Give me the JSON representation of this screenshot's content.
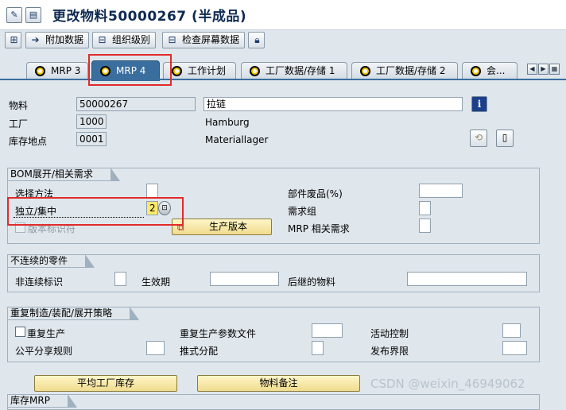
{
  "window": {
    "title": "更改物料50000267 (半成品)"
  },
  "toolbar": {
    "additional_data_label": "附加数据",
    "org_levels_label": "组织级别",
    "check_screen_data_label": "检查屏幕数据"
  },
  "tabs": [
    {
      "label": "MRP 3"
    },
    {
      "label": "MRP 4",
      "active": true
    },
    {
      "label": "工作计划"
    },
    {
      "label": "工厂数据/存储 1"
    },
    {
      "label": "工厂数据/存储 2"
    },
    {
      "label": "会..."
    }
  ],
  "header": {
    "material_label": "物料",
    "material_value": "50000267",
    "material_desc": "拉链",
    "plant_label": "工厂",
    "plant_value": "1000",
    "plant_desc": "Hamburg",
    "sloc_label": "库存地点",
    "sloc_value": "0001",
    "sloc_desc": "Materiallager"
  },
  "bom_group": {
    "title": "BOM展开/相关需求",
    "selection_method_label": "选择方法",
    "selection_method_value": "",
    "indiv_coll_label": "独立/集中",
    "indiv_coll_value": "2",
    "version_indicator_label": "版本标识符",
    "component_scrap_label": "部件废品(%)",
    "component_scrap_value": "",
    "req_group_label": "需求组",
    "req_group_value": "",
    "mrp_dep_req_label": "MRP 相关需求",
    "mrp_dep_req_value": "",
    "prod_version_button": "生产版本"
  },
  "discontinued_group": {
    "title": "不连续的零件",
    "disc_ind_label": "非连续标识",
    "disc_ind_value": "",
    "eff_out_label": "生效期",
    "eff_out_value": "",
    "follow_up_label": "后继的物料",
    "follow_up_value": ""
  },
  "repetitive_group": {
    "title": "重复制造/装配/展开策略",
    "repetitive_mfg_label": "重复生产",
    "rem_profile_label": "重复生产参数文件",
    "rem_profile_value": "",
    "action_control_label": "活动控制",
    "action_control_value": "",
    "fair_share_label": "公平分享规则",
    "fair_share_value": "",
    "push_dist_label": "推式分配",
    "push_dist_value": "",
    "deploy_horizon_label": "发布界限",
    "deploy_horizon_value": ""
  },
  "bottom_buttons": {
    "avg_plant_stock": "平均工厂库存",
    "material_memo": "物料备注"
  },
  "bottom_group_partial": {
    "title": "库存MRP"
  },
  "watermark": "CSDN @weixin_46949062",
  "colors": {
    "active_tab": "#3a6e9e",
    "highlight_box": "#e32a2a",
    "button_bg": "#f0dc8e"
  }
}
